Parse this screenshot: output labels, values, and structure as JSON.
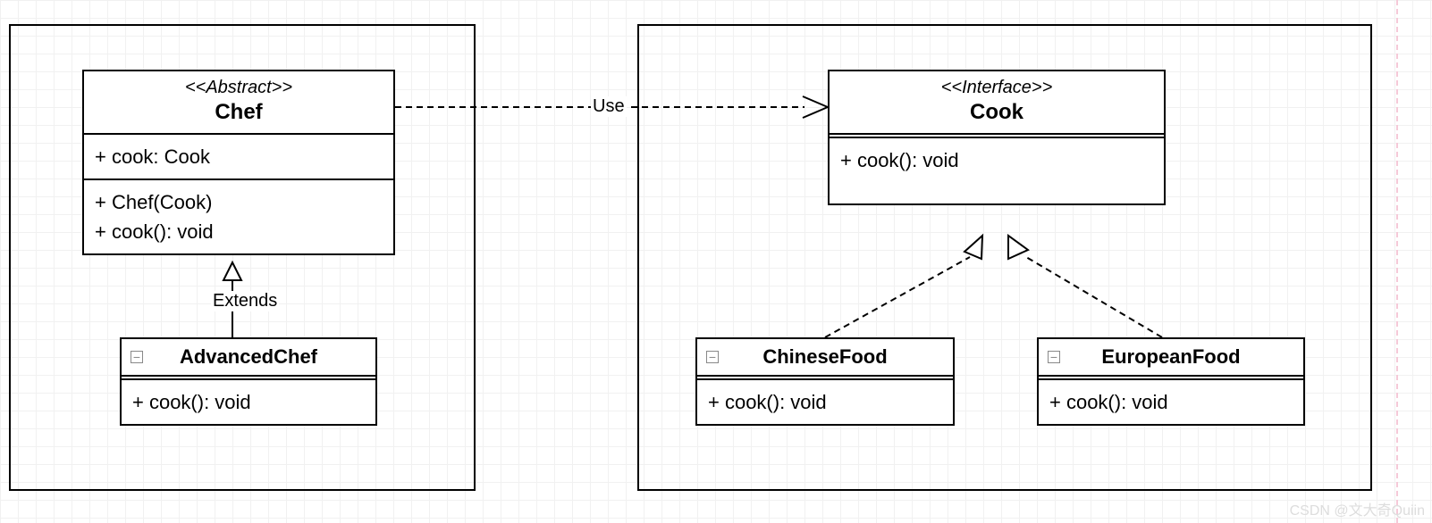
{
  "leftGroup": {
    "chef": {
      "stereotype": "<<Abstract>>",
      "name": "Chef",
      "attrs": [
        "+ cook: Cook"
      ],
      "ops": [
        "+ Chef(Cook)",
        "+ cook(): void"
      ]
    },
    "advancedChef": {
      "name": "AdvancedChef",
      "ops": [
        "+ cook(): void"
      ]
    },
    "relation": "Extends"
  },
  "rightGroup": {
    "cookInterface": {
      "stereotype": "<<Interface>>",
      "name": "Cook",
      "ops": [
        "+ cook(): void"
      ]
    },
    "chineseFood": {
      "name": "ChineseFood",
      "ops": [
        "+ cook(): void"
      ]
    },
    "europeanFood": {
      "name": "EuropeanFood",
      "ops": [
        "+ cook(): void"
      ]
    }
  },
  "useLabel": "Use",
  "watermark": "CSDN @文大奇Quiin"
}
